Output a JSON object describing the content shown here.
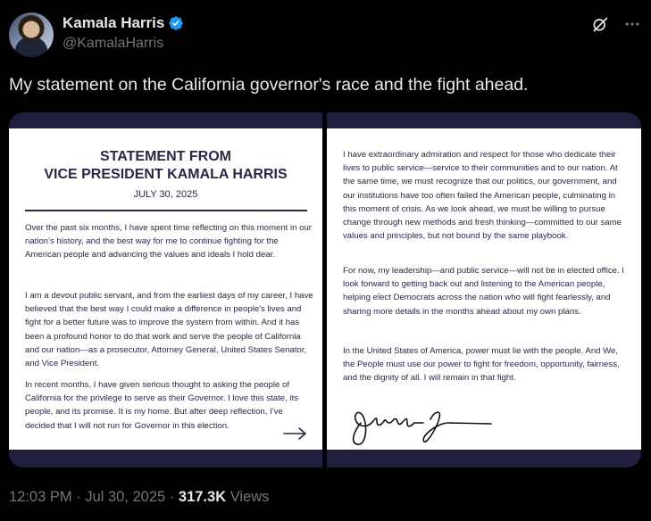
{
  "author": {
    "display_name": "Kamala Harris",
    "handle": "@KamalaHarris",
    "verified_color": "#1d9bf0"
  },
  "tweet": {
    "text": "My statement on the California governor's race and the fight ahead."
  },
  "statement": {
    "title_line1": "STATEMENT FROM",
    "title_line2": "VICE PRESIDENT KAMALA HARRIS",
    "date": "JULY 30, 2025",
    "left_paragraphs": [
      "Over the past six months, I have spent time reflecting on this moment in our nation's history, and the best way for me to continue fighting for the American people and advancing the values and ideals I hold dear.",
      "I am a devout public servant, and from the earliest days of my career, I have believed that the best way I could make a difference in people's lives and fight for a better future was to improve the system from within. And it has been a profound honor to do that work and serve the people of California and our nation—as a prosecutor, Attorney General, United States Senator, and Vice President.",
      "In recent months, I have given serious thought to asking the people of California for the privilege to serve as their Governor. I love this state, its people, and its promise. It is my home. But after deep reflection, I've decided that I will not run for Governor in this election."
    ],
    "right_paragraphs": [
      "I have extraordinary admiration and respect for those who dedicate their lives to public service—service to their communities and to our nation. At the same time, we must recognize that our politics, our government, and our institutions have too often failed the American people, culminating in this moment of crisis. As we look ahead, we must be willing to pursue change through new methods and fresh thinking—committed to our same values and principles, but not bound by the same playbook.",
      "For now, my leadership—and public service—will not be in elected office. I look forward to getting back out and listening to the American people, helping elect Democrats across the nation who will fight fearlessly, and sharing more details in the months ahead about my own plans.",
      "In the United States of America, power must lie with the people. And We, the People must use our power to fight for freedom, opportunity, fairness, and the dignity of all. I will remain in that fight."
    ],
    "signature_text": "Kamala Harris"
  },
  "meta": {
    "time": "12:03 PM",
    "date": "Jul 30, 2025",
    "views_count": "317.3K",
    "views_label": "Views",
    "separator": "·"
  },
  "icons": {
    "verified": "verified-badge-icon",
    "grok": "grok-icon",
    "more": "more-icon",
    "arrow": "arrow-right-icon"
  }
}
